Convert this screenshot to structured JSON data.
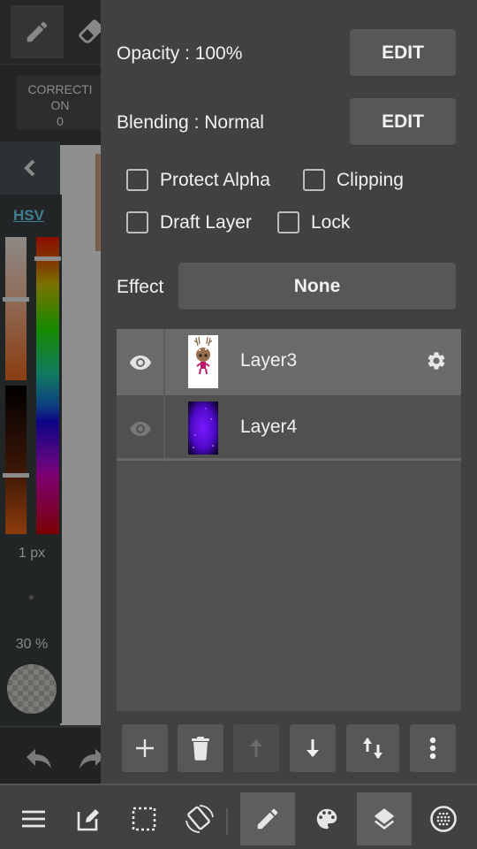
{
  "left_panel": {
    "correction_label": "CORRECTI\nON\n0",
    "color_mode": "HSV",
    "brush_size": "1 px",
    "brush_opacity": "30 %",
    "sliders": {
      "saturation": 0.43,
      "value": 0.6,
      "hue": 0.07
    }
  },
  "layer_panel": {
    "opacity_label": "Opacity : 100%",
    "opacity_edit": "EDIT",
    "blending_label": "Blending : Normal",
    "blending_edit": "EDIT",
    "checkboxes": [
      {
        "label": "Protect Alpha",
        "checked": false
      },
      {
        "label": "Clipping",
        "checked": false
      },
      {
        "label": "Draft Layer",
        "checked": false
      },
      {
        "label": "Lock",
        "checked": false
      }
    ],
    "effect_label": "Effect",
    "effect_value": "None",
    "layers": [
      {
        "name": "Layer3",
        "visible": true,
        "selected": true,
        "thumbnail": "deer-character"
      },
      {
        "name": "Layer4",
        "visible": true,
        "selected": false,
        "thumbnail": "purple-galaxy"
      }
    ],
    "actions": [
      {
        "icon": "plus-icon",
        "name": "add-layer-button",
        "enabled": true
      },
      {
        "icon": "trash-icon",
        "name": "delete-layer-button",
        "enabled": true
      },
      {
        "icon": "arrow-up-icon",
        "name": "move-layer-up-button",
        "enabled": false
      },
      {
        "icon": "arrow-down-icon",
        "name": "move-layer-down-button",
        "enabled": true
      },
      {
        "icon": "swap-icon",
        "name": "move-layer-button",
        "enabled": true
      },
      {
        "icon": "more-vertical-icon",
        "name": "more-options-button",
        "enabled": true
      }
    ]
  },
  "bottom_nav": {
    "items": [
      {
        "icon": "menu-icon",
        "active": false
      },
      {
        "icon": "edit-icon",
        "active": false
      },
      {
        "icon": "selection-icon",
        "active": false
      },
      {
        "icon": "rotate-icon",
        "active": false
      },
      {
        "icon": "pencil-icon",
        "active": true
      },
      {
        "icon": "palette-icon",
        "active": false
      },
      {
        "icon": "layers-icon",
        "active": true
      },
      {
        "icon": "material-icon",
        "active": false
      }
    ]
  },
  "colors": {
    "panel_bg": "#414141",
    "button_bg": "#575757",
    "selected_layer": "#6a6a6a",
    "hsv_link": "#3f7d91"
  }
}
